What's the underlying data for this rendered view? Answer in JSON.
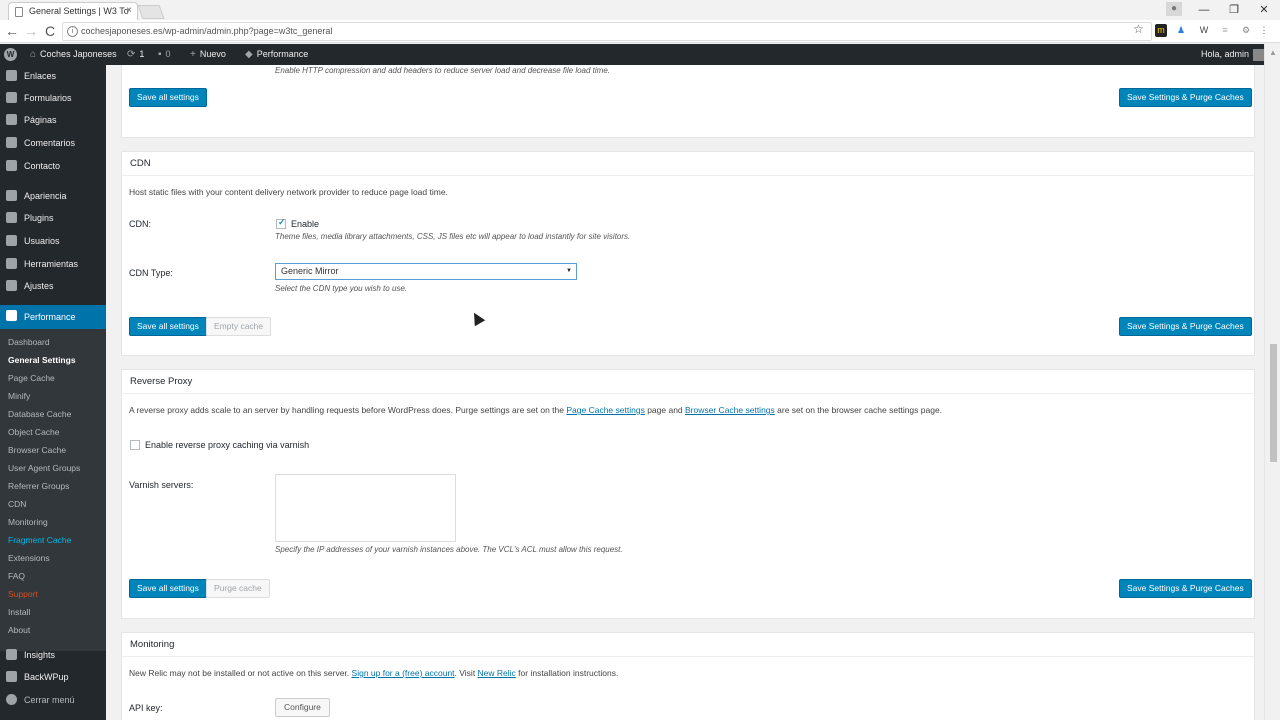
{
  "browser": {
    "tab_title": "General Settings | W3 To",
    "tab_close": "×",
    "url": "cochesjaponeses.es/wp-admin/admin.php?page=w3tc_general",
    "back": "←",
    "forward": "→",
    "reload": "C",
    "star": "☆",
    "minimize": "—",
    "restore": "❐",
    "close": "✕"
  },
  "adminbar": {
    "site_name": "Coches Japoneses",
    "updates_count": "1",
    "comments_count": "0",
    "new_label": "Nuevo",
    "performance_label": "Performance",
    "greeting": "Hola, admin"
  },
  "sidebar": {
    "items": [
      {
        "label": "Enlaces"
      },
      {
        "label": "Formularios"
      },
      {
        "label": "Páginas"
      },
      {
        "label": "Comentarios"
      },
      {
        "label": "Contacto"
      },
      {
        "label": "Apariencia"
      },
      {
        "label": "Plugins"
      },
      {
        "label": "Usuarios"
      },
      {
        "label": "Herramientas"
      },
      {
        "label": "Ajustes"
      },
      {
        "label": "Performance"
      }
    ],
    "submenu": [
      {
        "label": "Dashboard"
      },
      {
        "label": "General Settings"
      },
      {
        "label": "Page Cache"
      },
      {
        "label": "Minify"
      },
      {
        "label": "Database Cache"
      },
      {
        "label": "Object Cache"
      },
      {
        "label": "Browser Cache"
      },
      {
        "label": "User Agent Groups"
      },
      {
        "label": "Referrer Groups"
      },
      {
        "label": "CDN"
      },
      {
        "label": "Monitoring"
      },
      {
        "label": "Fragment Cache"
      },
      {
        "label": "Extensions"
      },
      {
        "label": "FAQ"
      },
      {
        "label": "Support"
      },
      {
        "label": "Install"
      },
      {
        "label": "About"
      }
    ],
    "bottom_items": [
      {
        "label": "Insights"
      },
      {
        "label": "BackWPup"
      },
      {
        "label": "Cerrar menú"
      }
    ]
  },
  "top_section": {
    "note_text": "Enable HTTP compression and add headers to reduce server load and decrease file load time.",
    "save_all": "Save all settings",
    "save_purge": "Save Settings & Purge Caches"
  },
  "cdn": {
    "title": "CDN",
    "description": "Host static files with your content delivery network provider to reduce page load time.",
    "cdn_label": "CDN:",
    "enable_label": "Enable",
    "enable_checked": true,
    "enable_note": "Theme files, media library attachments, CSS, JS files etc will appear to load instantly for site visitors.",
    "type_label": "CDN Type:",
    "type_value": "Generic Mirror",
    "type_caret": "▼",
    "type_note": "Select the CDN type you wish to use.",
    "save_all": "Save all settings",
    "empty_cache": "Empty cache",
    "save_purge": "Save Settings & Purge Caches"
  },
  "reverse_proxy": {
    "title": "Reverse Proxy",
    "desc_part1": "A reverse proxy adds scale to an server by handling requests before WordPress does. Purge settings are set on the ",
    "link1": "Page Cache settings",
    "desc_part2": " page and ",
    "link2": "Browser Cache settings",
    "desc_part3": " are set on the browser cache settings page.",
    "varnish_checkbox_label": "Enable reverse proxy caching via varnish",
    "varnish_checked": false,
    "servers_label": "Varnish servers:",
    "servers_value": "",
    "servers_note": "Specify the IP addresses of your varnish instances above. The VCL's ACL must allow this request.",
    "save_all": "Save all settings",
    "purge_cache": "Purge cache",
    "save_purge": "Save Settings & Purge Caches"
  },
  "monitoring": {
    "title": "Monitoring",
    "desc_part1": "New Relic may not be installed or not active on this server. ",
    "link1": "Sign up for a (free) account",
    "desc_part2": ". Visit ",
    "link2": "New Relic",
    "desc_part3": " for installation instructions.",
    "api_key_label": "API key:",
    "configure": "Configure"
  }
}
